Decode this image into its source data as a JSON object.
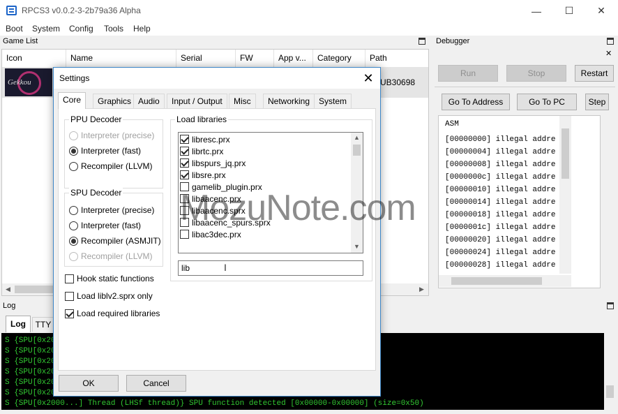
{
  "window": {
    "title": "RPCS3 v0.0.2-3-2b79a36 Alpha"
  },
  "icons": {
    "minimize": "—",
    "maximize": "☐",
    "close": "✕",
    "dialog_close": "✕"
  },
  "menu": [
    "Boot",
    "System",
    "Config",
    "Tools",
    "Help"
  ],
  "game_list": {
    "title": "Game List",
    "columns": [
      "Icon",
      "Name",
      "Serial",
      "FW",
      "App v...",
      "Category",
      "Path"
    ],
    "row": {
      "icon_text": "Gekkou",
      "path": "UB30698"
    }
  },
  "debugger": {
    "title": "Debugger",
    "buttons": {
      "run": "Run",
      "stop": "Stop",
      "restart": "Restart",
      "go_to_address": "Go To Address",
      "go_to_pc": "Go To PC",
      "step": "Step"
    },
    "asm_header": "ASM",
    "asm_lines": [
      "[00000000] illegal addre",
      "[00000004] illegal addre",
      "[00000008] illegal addre",
      "[0000000c] illegal addre",
      "[00000010] illegal addre",
      "[00000014] illegal addre",
      "[00000018] illegal addre",
      "[0000001c] illegal addre",
      "[00000020] illegal addre",
      "[00000024] illegal addre",
      "[00000028] illegal addre"
    ]
  },
  "log": {
    "title": "Log",
    "tabs": [
      "Log",
      "TTY"
    ],
    "lines": [
      "S {SPU[0x2000",
      "S {SPU[0x2000",
      "S {SPU[0x2000",
      "S {SPU[0x2000",
      "S {SPU[0x2000",
      "S {SPU[0x2000"
    ],
    "last_line": "S {SPU[0x2000...] Thread (LHSf thread)} SPU function detected [0x00000-0x00000] (size=0x50)"
  },
  "settings": {
    "title": "Settings",
    "tabs": [
      "Core",
      "Graphics",
      "Audio",
      "Input / Output",
      "Misc",
      "Networking",
      "System"
    ],
    "active_tab": "Core",
    "ppu": {
      "title": "PPU Decoder",
      "options": [
        {
          "label": "Interpreter (precise)",
          "checked": false,
          "disabled": true
        },
        {
          "label": "Interpreter (fast)",
          "checked": true,
          "disabled": false
        },
        {
          "label": "Recompiler (LLVM)",
          "checked": false,
          "disabled": false
        }
      ]
    },
    "spu": {
      "title": "SPU Decoder",
      "options": [
        {
          "label": "Interpreter (precise)",
          "checked": false,
          "disabled": false
        },
        {
          "label": "Interpreter (fast)",
          "checked": false,
          "disabled": false
        },
        {
          "label": "Recompiler (ASMJIT)",
          "checked": true,
          "disabled": false
        },
        {
          "label": "Recompiler (LLVM)",
          "checked": false,
          "disabled": true
        }
      ]
    },
    "checks": [
      {
        "label": "Hook static functions",
        "checked": false
      },
      {
        "label": "Load liblv2.sprx only",
        "checked": false
      },
      {
        "label": "Load required libraries",
        "checked": true
      }
    ],
    "libraries": {
      "title": "Load libraries",
      "items": [
        {
          "name": "libresc.prx",
          "checked": true
        },
        {
          "name": "librtc.prx",
          "checked": true
        },
        {
          "name": "libspurs_jq.prx",
          "checked": true
        },
        {
          "name": "libsre.prx",
          "checked": true
        },
        {
          "name": "gamelib_plugin.prx",
          "checked": false
        },
        {
          "name": "libaacenc.prx",
          "checked": false
        },
        {
          "name": "libaacenc.sprx",
          "checked": false
        },
        {
          "name": "libaacenc_spurs.sprx",
          "checked": false
        },
        {
          "name": "libac3dec.prx",
          "checked": false
        }
      ],
      "filter": "lib"
    },
    "ok": "OK",
    "cancel": "Cancel"
  },
  "watermark": "MozuNote.com"
}
